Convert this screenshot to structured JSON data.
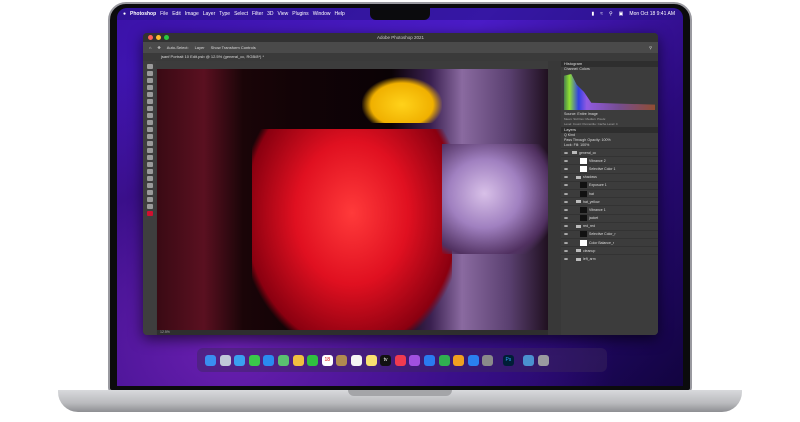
{
  "menubar": {
    "app": "Photoshop",
    "items": [
      "File",
      "Edit",
      "Image",
      "Layer",
      "Type",
      "Select",
      "Filter",
      "3D",
      "View",
      "Plugins",
      "Window",
      "Help"
    ],
    "clock": "Mon Oct 18  9:41 AM"
  },
  "window": {
    "title": "Adobe Photoshop 2021",
    "document_tab": "jsanf Portrait 10 Edit.psb @ 12.5% (general_cc, RGB/8*) *",
    "auto_select": "Auto-Select:",
    "layer_select": "Layer",
    "transform": "Show Transform Controls",
    "status": "12.5%"
  },
  "histogram": {
    "title": "Histogram",
    "channel_label": "Channel:",
    "channel": "Colors",
    "source_label": "Source:",
    "source": "Entire Image",
    "stats": [
      "Mean:",
      "Std Dev:",
      "Median:",
      "Pixels:",
      "Level:",
      "Count:",
      "Percentile:",
      "Cache Level: 4"
    ]
  },
  "layers": {
    "title": "Layers",
    "kind": "Q Kind",
    "blend": "Pass Through",
    "opacity": "Opacity: 100%",
    "lock": "Lock:",
    "fill": "Fill: 100%",
    "items": [
      {
        "name": "general_cc",
        "type": "group"
      },
      {
        "name": "Vibrance 2",
        "type": "adj"
      },
      {
        "name": "Selective Color 1",
        "type": "adj"
      },
      {
        "name": "shadows",
        "type": "group"
      },
      {
        "name": "Exposure 1",
        "type": "mask"
      },
      {
        "name": "hat",
        "type": "mask"
      },
      {
        "name": "hat_yellow",
        "type": "group"
      },
      {
        "name": "Vibrance 1",
        "type": "mask"
      },
      {
        "name": "jacket",
        "type": "mask"
      },
      {
        "name": "red_red",
        "type": "group"
      },
      {
        "name": "Selective Color_r",
        "type": "mask"
      },
      {
        "name": "Color Balance_r",
        "type": "adj"
      },
      {
        "name": "cleanup",
        "type": "group"
      },
      {
        "name": "left_arm",
        "type": "group"
      }
    ]
  },
  "dock": {
    "apps": [
      {
        "name": "finder",
        "color": "#3a8ef0"
      },
      {
        "name": "launchpad",
        "color": "#c0c8d8"
      },
      {
        "name": "safari",
        "color": "#3aa0f0"
      },
      {
        "name": "messages",
        "color": "#3ac84a"
      },
      {
        "name": "mail",
        "color": "#2a8af0"
      },
      {
        "name": "maps",
        "color": "#5ac070"
      },
      {
        "name": "photos",
        "color": "#f0c040"
      },
      {
        "name": "facetime",
        "color": "#30c040"
      },
      {
        "name": "calendar",
        "color": "#ffffff",
        "label": "18"
      },
      {
        "name": "contacts",
        "color": "#b08a50"
      },
      {
        "name": "reminders",
        "color": "#f4f4f4"
      },
      {
        "name": "notes",
        "color": "#f8e070"
      },
      {
        "name": "tv",
        "color": "#111111",
        "label": "tv"
      },
      {
        "name": "music",
        "color": "#f03a50"
      },
      {
        "name": "podcasts",
        "color": "#a050e0"
      },
      {
        "name": "keynote",
        "color": "#2a7af0"
      },
      {
        "name": "numbers",
        "color": "#30b050"
      },
      {
        "name": "pages",
        "color": "#f0a020"
      },
      {
        "name": "app-store",
        "color": "#2a80f0"
      },
      {
        "name": "system-preferences",
        "color": "#8a8a8a"
      },
      {
        "name": "photoshop",
        "color": "#001e36",
        "label": "Ps"
      },
      {
        "name": "downloads-folder",
        "color": "#4a90d0"
      },
      {
        "name": "trash",
        "color": "#9a9aa0"
      }
    ]
  },
  "colors": {
    "wallpaper": "#3b12a8",
    "ps_panel": "#3c3c3c",
    "accent_yellow": "#ffd21a"
  }
}
